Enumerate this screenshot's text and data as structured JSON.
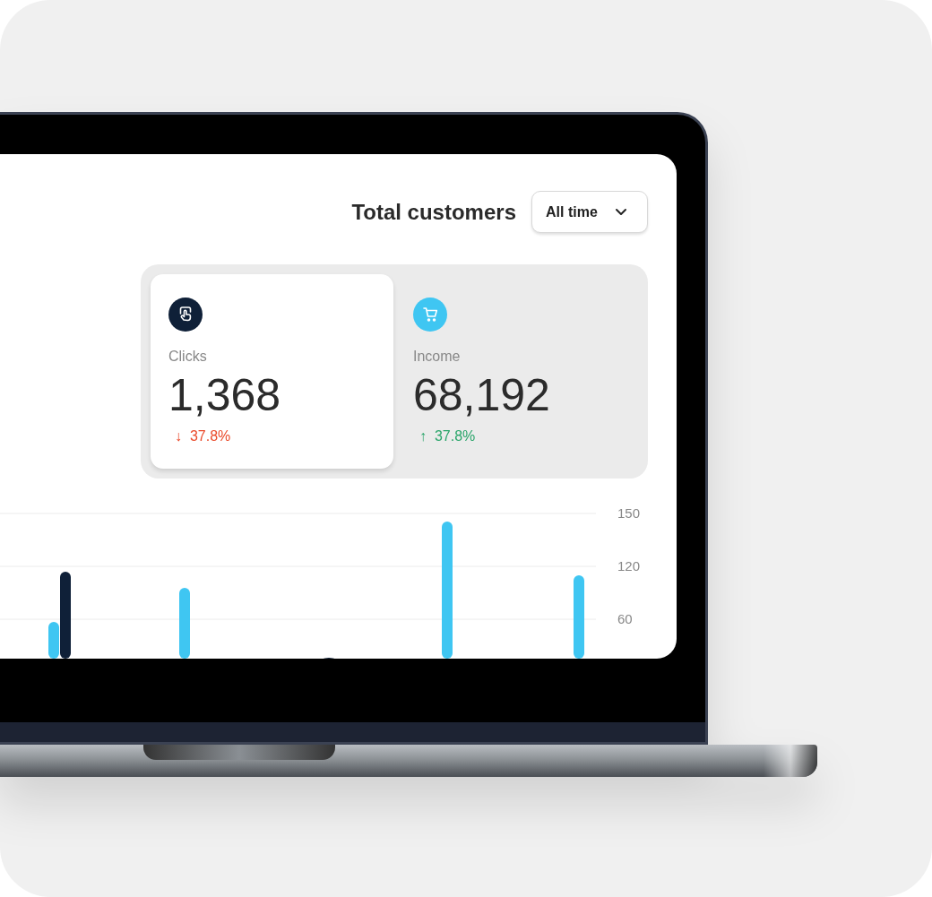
{
  "header": {
    "title": "Total customers",
    "dropdown": {
      "label": "All time"
    }
  },
  "stats": [
    {
      "kind": "clicks",
      "color": "#0f2038",
      "label": "Clicks",
      "value": "1,368",
      "arrow": "↓",
      "change": "37.8%",
      "negative": true,
      "selected": true
    },
    {
      "kind": "income",
      "color": "#3fc6f2",
      "label": "Income",
      "value": "68,192",
      "arrow": "↑",
      "change": "37.8%",
      "negative": false,
      "selected": false
    }
  ],
  "chart": {
    "y_labels": [
      "150",
      "120",
      "60"
    ]
  }
}
